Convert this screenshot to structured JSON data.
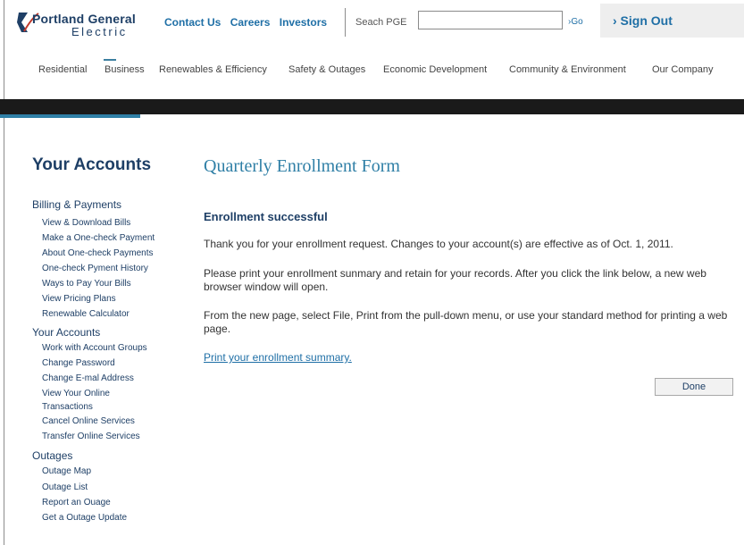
{
  "header": {
    "logo_line1": "Portland General",
    "logo_line2": "Electric",
    "top_links": [
      "Contact Us",
      "Careers",
      "Investors"
    ],
    "search_label": "Seach PGE",
    "search_value": "",
    "go_label": "›Go",
    "signout_label": "› Sign Out",
    "brand_color": "#1e3f66",
    "link_color": "#1f6fa6"
  },
  "nav": {
    "items": [
      "Residential",
      "Business",
      "Renewables & Efficiency",
      "Safety & Outages",
      "Economic Development",
      "Community & Environment",
      "Our Company"
    ],
    "active": "Business"
  },
  "sidebar": {
    "title": "Your Accounts",
    "sections": [
      {
        "heading": "Billing & Payments",
        "items": [
          "View & Download Bills",
          "Make a One-check Payment",
          "About One-check Payments",
          "One-check Pyment History",
          "Ways to Pay Your Bills",
          "View Pricing Plans",
          "Renewable Calculator"
        ]
      },
      {
        "heading": "Your Accounts",
        "items": [
          "Work with Account Groups",
          "Change Password",
          "Change E-mal Address",
          "View Your Online",
          "Transactions",
          "Cancel Online Services",
          "Transfer Online Services"
        ]
      },
      {
        "heading": "Outages",
        "items": [
          "Outage Map",
          "Outage List",
          "Report an Ouage",
          "Get a Outage Update"
        ]
      }
    ]
  },
  "main": {
    "form_title": "Quarterly Enrollment Form",
    "success_heading": "Enrollment successful",
    "para1": "Thank you for your enrollment request. Changes to your account(s) are effective as of Oct. 1, 2011.",
    "para2": "Please print your enrollment sunmary and retain for your records. After you click the link below, a new web browser window will open.",
    "para3": "From the new page, select File, Print from the pull-down menu, or use your standard method for printing a web page.",
    "print_link": "Print your enrollment summary.",
    "done_label": "Done"
  }
}
